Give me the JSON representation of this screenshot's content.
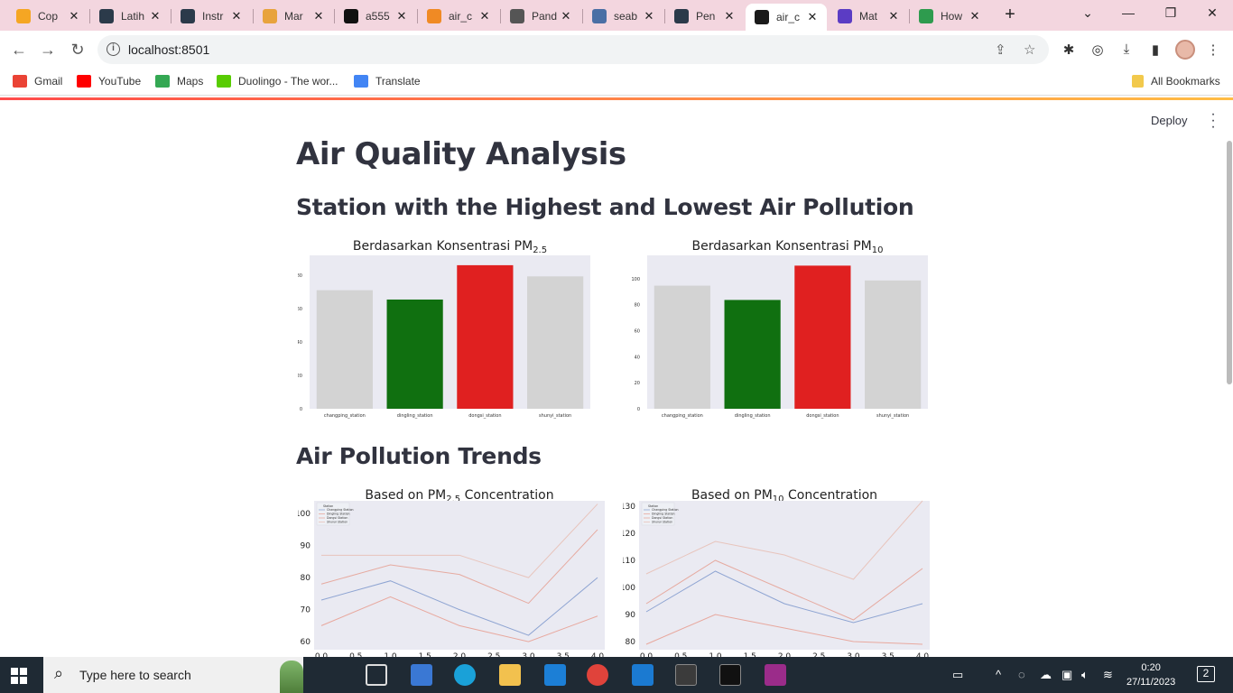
{
  "browser": {
    "tabs": [
      {
        "title": "Cop",
        "color": "#f5a623"
      },
      {
        "title": "Latih",
        "color": "#2b3a4a"
      },
      {
        "title": "Instr",
        "color": "#2b3a4a"
      },
      {
        "title": "Mar",
        "color": "#e8a33d"
      },
      {
        "title": "a555",
        "color": "#111111"
      },
      {
        "title": "air_c",
        "color": "#f08a24"
      },
      {
        "title": "Pand",
        "color": "#555555"
      },
      {
        "title": "seab",
        "color": "#4a6fa5"
      },
      {
        "title": "Pen",
        "color": "#2b3a4a"
      },
      {
        "title": "air_c",
        "color": "#1a1a1a"
      },
      {
        "title": "Mat",
        "color": "#5b3cc4"
      },
      {
        "title": "How",
        "color": "#2e9b4e"
      }
    ],
    "active_tab_index": 9,
    "new_tab": "+",
    "url": "localhost:8501",
    "bookmarks": [
      {
        "label": "Gmail",
        "color": "#ea4335"
      },
      {
        "label": "YouTube",
        "color": "#ff0000"
      },
      {
        "label": "Maps",
        "color": "#34a853"
      },
      {
        "label": "Duolingo - The wor...",
        "color": "#58cc02"
      },
      {
        "label": "Translate",
        "color": "#4285f4"
      }
    ],
    "all_bookmarks": "All Bookmarks"
  },
  "app": {
    "deploy_label": "Deploy",
    "title": "Air Quality Analysis",
    "section1": "Station with the Highest and Lowest Air Pollution",
    "section2": "Air Pollution Trends"
  },
  "colors": {
    "accent_red": "#ff4b4b",
    "bar_gray": "#d3d3d3",
    "bar_green": "#107010",
    "bar_red": "#e02020",
    "plot_bg": "#eaeaf2",
    "line_changping": "#8ea4d2",
    "line_dingling": "#e8a89e",
    "line_dongsi": "#e6aaa0",
    "line_shunyi": "#e8c4bc"
  },
  "chart_data": [
    {
      "type": "bar",
      "title": "Berdasarkan Konsentrasi PM",
      "title_sub": "2.5",
      "categories": [
        "changping_station",
        "dingling_station",
        "dongsi_station",
        "shunyi_station"
      ],
      "values": [
        71.1,
        65.5,
        86.1,
        79.4
      ],
      "highlight": [
        "gray",
        "green",
        "red",
        "gray"
      ],
      "yticks": [
        "0",
        "20",
        "40",
        "60",
        "80"
      ],
      "ylim": [
        0,
        92
      ]
    },
    {
      "type": "bar",
      "title": "Berdasarkan Konsentrasi PM",
      "title_sub": "10",
      "categories": [
        "changping_station",
        "dingling_station",
        "dongsi_station",
        "shunyi_station"
      ],
      "values": [
        94.7,
        83.7,
        110.1,
        98.7
      ],
      "highlight": [
        "gray",
        "green",
        "red",
        "gray"
      ],
      "yticks": [
        "0",
        "20",
        "40",
        "60",
        "80",
        "100"
      ],
      "ylim": [
        0,
        118
      ]
    },
    {
      "type": "line",
      "title": "Based on PM",
      "title_sub": "2.5",
      "title_suffix": "Concentration",
      "x": [
        0,
        1,
        2,
        3,
        4
      ],
      "xticks": [
        "0.0",
        "0.5",
        "1.0",
        "1.5",
        "2.0",
        "2.5",
        "3.0",
        "3.5",
        "4.0"
      ],
      "yticks": [
        "60",
        "70",
        "80",
        "90",
        "100"
      ],
      "ylim": [
        57.5,
        104
      ],
      "legend_title": "Station",
      "series": [
        {
          "name": "Changping Station",
          "values": [
            73,
            79,
            70,
            62,
            80
          ]
        },
        {
          "name": "Dingling Station",
          "values": [
            65,
            74,
            65,
            60,
            68
          ]
        },
        {
          "name": "Dongsi Station",
          "values": [
            78,
            84,
            81,
            72,
            95
          ]
        },
        {
          "name": "Shunyi Station",
          "values": [
            87,
            87,
            87,
            80,
            103
          ]
        }
      ]
    },
    {
      "type": "line",
      "title": "Based on PM",
      "title_sub": "10",
      "title_suffix": "Concentration",
      "x": [
        0,
        1,
        2,
        3,
        4
      ],
      "xticks": [
        "0.0",
        "0.5",
        "1.0",
        "1.5",
        "2.0",
        "2.5",
        "3.0",
        "3.5",
        "4.0"
      ],
      "yticks": [
        "80",
        "90",
        "100",
        "110",
        "120",
        "130"
      ],
      "ylim": [
        77,
        132
      ],
      "legend_title": "Station",
      "series": [
        {
          "name": "Changping Station",
          "values": [
            91,
            106,
            94,
            87,
            94
          ]
        },
        {
          "name": "Dingling Station",
          "values": [
            79,
            90,
            85,
            80,
            79
          ]
        },
        {
          "name": "Dongsi Station",
          "values": [
            94,
            110,
            99,
            88,
            107
          ]
        },
        {
          "name": "Shunyi Station",
          "values": [
            105,
            117,
            112,
            103,
            132
          ]
        }
      ]
    }
  ],
  "taskbar": {
    "search_placeholder": "Type here to search",
    "time": "0:20",
    "date": "27/11/2023",
    "notifications": "2"
  }
}
